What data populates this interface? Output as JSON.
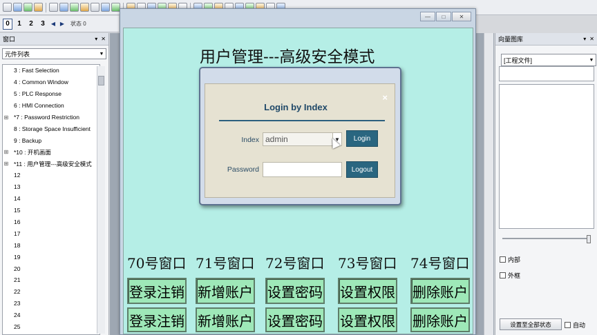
{
  "toolbar": {
    "icons": [
      "pointer-icon",
      "hand-icon",
      "zoom-icon",
      "copy-icon",
      "line-icon",
      "polyline-icon",
      "arc-icon",
      "circle-icon",
      "rectangle-icon",
      "star-icon",
      "text-icon",
      "image-icon",
      "table-icon",
      "bar-icon",
      "button-icon",
      "lamp-icon",
      "input-icon",
      "number-icon",
      "chart-icon",
      "gauge-icon",
      "meter-icon",
      "clock-icon",
      "slider-icon",
      "switch-icon",
      "calendar-icon",
      "flag-icon"
    ]
  },
  "state_row": {
    "buttons": [
      "0",
      "1",
      "2",
      "3"
    ],
    "selected": "0",
    "state_label": "状态 0"
  },
  "left_panel": {
    "title": "窗口",
    "combo_value": "元件列表",
    "tree_items": [
      {
        "text": "3 : Fast Selection",
        "expander": ""
      },
      {
        "text": "4 : Common Window",
        "expander": ""
      },
      {
        "text": "5 : PLC Response",
        "expander": ""
      },
      {
        "text": "6 : HMI Connection",
        "expander": ""
      },
      {
        "text": "*7 : Password Restriction",
        "expander": "⊞"
      },
      {
        "text": "8 : Storage Space Insufficient",
        "expander": ""
      },
      {
        "text": "9 : Backup",
        "expander": ""
      },
      {
        "text": "*10 : 开机画面",
        "expander": "⊞"
      },
      {
        "text": "*11 : 用户管理---高级安全模式",
        "expander": "⊞"
      },
      {
        "text": "12",
        "expander": ""
      },
      {
        "text": "13",
        "expander": ""
      },
      {
        "text": "14",
        "expander": ""
      },
      {
        "text": "15",
        "expander": ""
      },
      {
        "text": "16",
        "expander": ""
      },
      {
        "text": "17",
        "expander": ""
      },
      {
        "text": "18",
        "expander": ""
      },
      {
        "text": "19",
        "expander": ""
      },
      {
        "text": "20",
        "expander": ""
      },
      {
        "text": "21",
        "expander": ""
      },
      {
        "text": "22",
        "expander": ""
      },
      {
        "text": "23",
        "expander": ""
      },
      {
        "text": "24",
        "expander": ""
      },
      {
        "text": "25",
        "expander": ""
      }
    ]
  },
  "main_window": {
    "screen_title": "用户管理---高级安全模式",
    "window_labels": [
      "70号窗口",
      "71号窗口",
      "72号窗口",
      "73号窗口",
      "74号窗口"
    ],
    "buttons": [
      "登录注销",
      "新增账户",
      "设置密码",
      "设置权限",
      "删除账户"
    ]
  },
  "login_dialog": {
    "heading": "Login by Index",
    "close": "×",
    "index_label": "Index",
    "index_value": "admin",
    "password_label": "Password",
    "login_button": "Login",
    "logout_button": "Logout"
  },
  "right_panel": {
    "title": "向量图库",
    "combo_value": "[工程文件]",
    "check_internal": "内部",
    "check_frame": "外框",
    "set_all_button": "设置至全部状态",
    "auto_label": "自动"
  },
  "colors": {
    "screen_bg": "#b5eee6",
    "button_bg": "#9ee8b8",
    "login_accent": "#2a6680"
  }
}
